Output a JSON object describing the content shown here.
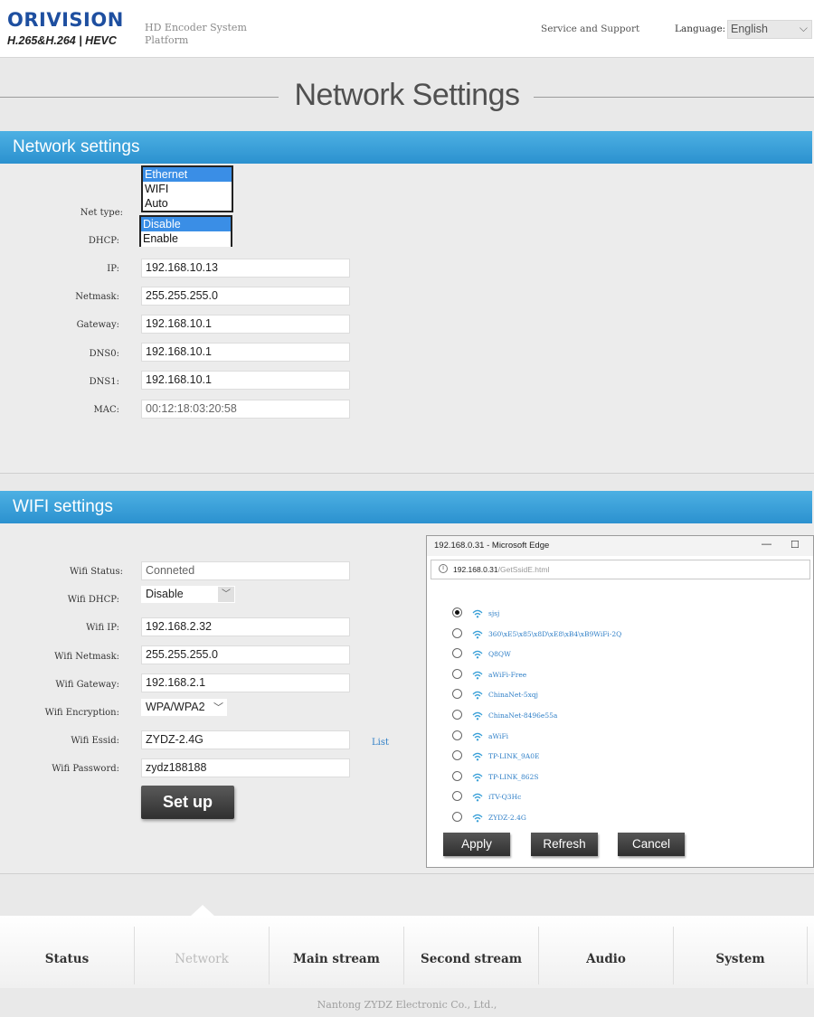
{
  "header": {
    "logo": "ORIVISION",
    "logo_sub": "H.265&H.264 | HEVC",
    "platform": "HD Encoder System Platform",
    "service": "Service and Support",
    "language_label": "Language:",
    "language_value": "English"
  },
  "page_title": "Network Settings",
  "network": {
    "heading": "Network settings",
    "net_type_label": "Net type:",
    "net_type_options": [
      "Ethernet",
      "WIFI",
      "Auto"
    ],
    "net_type_selected": "Ethernet",
    "dhcp_label": "DHCP:",
    "dhcp_options": [
      "Disable",
      "Enable"
    ],
    "dhcp_selected": "Disable",
    "ip_label": "IP:",
    "ip": "192.168.10.13",
    "netmask_label": "Netmask:",
    "netmask": "255.255.255.0",
    "gateway_label": "Gateway:",
    "gateway": "192.168.10.1",
    "dns0_label": "DNS0:",
    "dns0": "192.168.10.1",
    "dns1_label": "DNS1:",
    "dns1": "192.168.10.1",
    "mac_label": "MAC:",
    "mac": "00:12:18:03:20:58"
  },
  "wifi": {
    "heading": "WIFI settings",
    "status_label": "Wifi Status:",
    "status": "Conneted",
    "dhcp_label": "Wifi DHCP:",
    "dhcp": "Disable",
    "ip_label": "Wifi IP:",
    "ip": "192.168.2.32",
    "netmask_label": "Wifi Netmask:",
    "netmask": "255.255.255.0",
    "gateway_label": "Wifi Gateway:",
    "gateway": "192.168.2.1",
    "encryption_label": "Wifi Encryption:",
    "encryption": "WPA/WPA2",
    "essid_label": "Wifi Essid:",
    "essid": "ZYDZ-2.4G",
    "list_link": "List",
    "password_label": "Wifi Password:",
    "password": "zydz188188",
    "setup_button": "Set up"
  },
  "popup": {
    "window_title": "192.168.0.31 - Microsoft Edge",
    "minimize": "—",
    "maximize": "☐",
    "url_host": "192.168.0.31",
    "url_path": "/GetSsidE.html",
    "ssids": [
      {
        "name": "sjsj",
        "selected": true
      },
      {
        "name": "360\\xE5\\x85\\x8D\\xE8\\xB4\\xB9WiFi-2Q",
        "selected": false
      },
      {
        "name": "Q8QW",
        "selected": false
      },
      {
        "name": "aWiFi-Free",
        "selected": false
      },
      {
        "name": "ChinaNet-5xqj",
        "selected": false
      },
      {
        "name": "ChinaNet-8496e55a",
        "selected": false
      },
      {
        "name": "aWiFi",
        "selected": false
      },
      {
        "name": "TP-LINK_9A0E",
        "selected": false
      },
      {
        "name": "TP-LINK_862S",
        "selected": false
      },
      {
        "name": "iTV-Q3Hc",
        "selected": false
      },
      {
        "name": "ZYDZ-2.4G",
        "selected": false
      }
    ],
    "apply": "Apply",
    "refresh": "Refresh",
    "cancel": "Cancel"
  },
  "nav": {
    "items": [
      "Status",
      "Network",
      "Main stream",
      "Second stream",
      "Audio",
      "System"
    ],
    "active": "Network"
  },
  "footer": "Nantong ZYDZ Electronic Co., Ltd.,",
  "colors": {
    "accent": "#2b91cf",
    "brand": "#1e4fa0",
    "link": "#2f7fc7"
  }
}
